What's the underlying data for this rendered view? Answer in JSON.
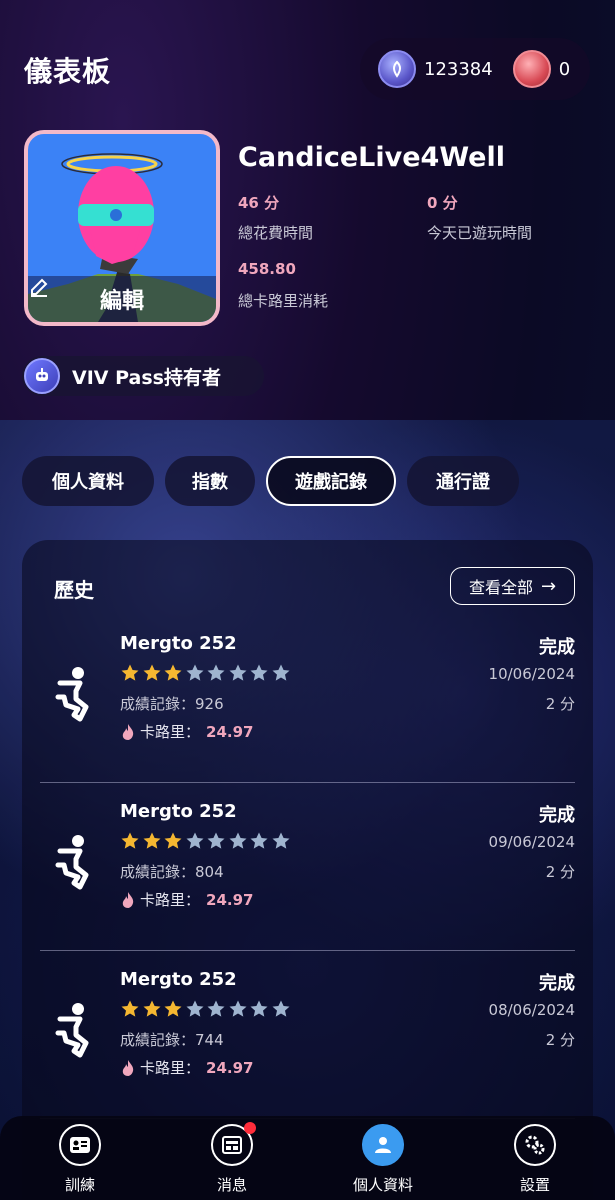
{
  "header": {
    "title": "儀表板"
  },
  "wallet": {
    "coin_a_value": "123384",
    "coin_b_value": "0"
  },
  "profile": {
    "edit_label": "編輯",
    "username": "CandiceLive4Well",
    "stats": [
      {
        "value": "46 分",
        "label": "總花費時間"
      },
      {
        "value": "0 分",
        "label": "今天已遊玩時間"
      },
      {
        "value": "458.80",
        "label": "總卡路里消耗"
      }
    ],
    "pass_label": "VIV Pass持有者"
  },
  "tabs": [
    {
      "label": "個人資料",
      "active": false
    },
    {
      "label": "指數",
      "active": false
    },
    {
      "label": "遊戲記錄",
      "active": true
    },
    {
      "label": "通行證",
      "active": false
    }
  ],
  "history": {
    "title": "歷史",
    "view_all_label": "查看全部",
    "stars_filled_color": "#f5b731",
    "stars_empty_color": "#9fb4cf",
    "entries": [
      {
        "name": "Mergto 252",
        "stars_filled": 3,
        "stars_total": 8,
        "score_label": "成績記錄：",
        "score": "926",
        "calorie_label": "卡路里：",
        "calories": "24.97",
        "status": "完成",
        "date": "10/06/2024",
        "duration": "2 分"
      },
      {
        "name": "Mergto 252",
        "stars_filled": 3,
        "stars_total": 8,
        "score_label": "成績記錄：",
        "score": "804",
        "calorie_label": "卡路里：",
        "calories": "24.97",
        "status": "完成",
        "date": "09/06/2024",
        "duration": "2 分"
      },
      {
        "name": "Mergto 252",
        "stars_filled": 3,
        "stars_total": 8,
        "score_label": "成績記錄：",
        "score": "744",
        "calorie_label": "卡路里：",
        "calories": "24.97",
        "status": "完成",
        "date": "08/06/2024",
        "duration": "2 分"
      }
    ]
  },
  "nav": [
    {
      "label": "訓練",
      "icon": "training-icon",
      "active": false
    },
    {
      "label": "消息",
      "icon": "news-icon",
      "active": false,
      "has_badge": true
    },
    {
      "label": "個人資料",
      "icon": "profile-icon",
      "active": true
    },
    {
      "label": "設置",
      "icon": "settings-icon",
      "active": false
    }
  ]
}
